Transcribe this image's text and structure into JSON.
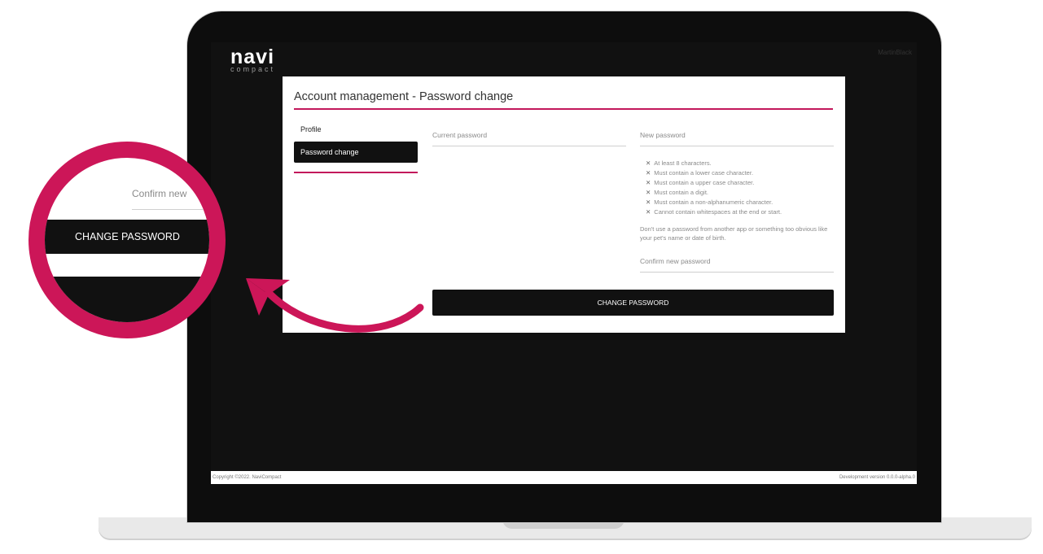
{
  "app": {
    "logo_main": "navi",
    "logo_sub": "compact",
    "user_menu": "MartinBlack"
  },
  "card": {
    "title": "Account management - Password change",
    "nav": {
      "profile": "Profile",
      "password_change": "Password change"
    },
    "current_password_placeholder": "Current password",
    "new_password_placeholder": "New password",
    "rules": [
      "At least 8 characters.",
      "Must contain a lower case character.",
      "Must contain a upper case character.",
      "Must contain a digit.",
      "Must contain a non-alphanumeric character.",
      "Cannot contain whitespaces at the end or start."
    ],
    "rule_marker": "✕",
    "hint": "Don't use a password from another app or something too obvious like your pet's name or date of birth.",
    "confirm_placeholder": "Confirm new password",
    "submit_label": "CHANGE PASSWORD"
  },
  "footer": {
    "copyright": "Copyright ©2022. NaviCompact",
    "version": "Development version 0.0.0-alpha.0"
  },
  "callout": {
    "confirm_label": "Confirm new",
    "button_label": "CHANGE PASSWORD"
  },
  "colors": {
    "accent": "#c2185b",
    "dark": "#111111"
  }
}
